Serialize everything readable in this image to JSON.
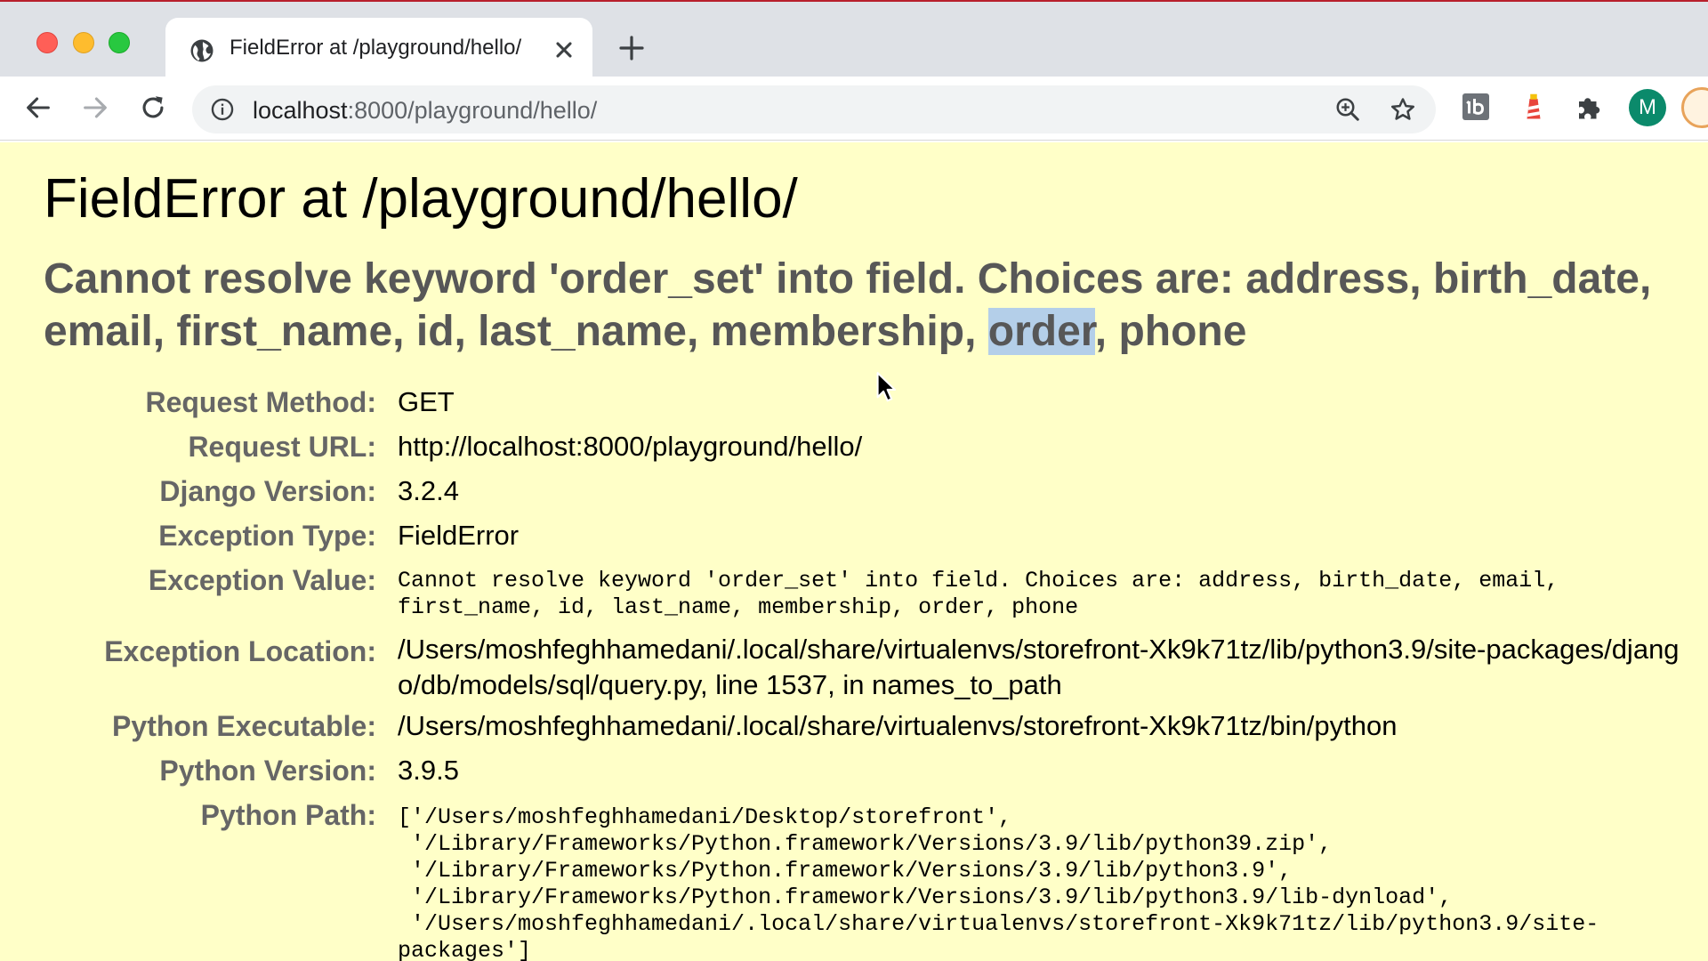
{
  "browser": {
    "tab_title": "FieldError at /playground/hello/",
    "url_host": "localhost",
    "url_rest": ":8000/playground/hello/",
    "profile_initial": "M",
    "accent": "#b8202c"
  },
  "page": {
    "title": "FieldError at /playground/hello/",
    "message_before": "Cannot resolve keyword 'order_set' into field. Choices are: address, birth_date, email, first_name, id, last_name, membership, ",
    "message_highlight": "order",
    "message_after": ", phone",
    "background": "#ffffc8",
    "meta": [
      {
        "label": "Request Method:",
        "value": "GET"
      },
      {
        "label": "Request URL:",
        "value": "http://localhost:8000/playground/hello/"
      },
      {
        "label": "Django Version:",
        "value": "3.2.4"
      },
      {
        "label": "Exception Type:",
        "value": "FieldError"
      },
      {
        "label": "Exception Value:",
        "value": "Cannot resolve keyword 'order_set' into field. Choices are: address, birth_date, email,\nfirst_name, id, last_name, membership, order, phone"
      },
      {
        "label": "Exception Location:",
        "value": "/Users/moshfeghhamedani/.local/share/virtualenvs/storefront-Xk9k71tz/lib/python3.9/site-packages/django/db/models/sql/query.py, line 1537, in names_to_path"
      },
      {
        "label": "Python Executable:",
        "value": "/Users/moshfeghhamedani/.local/share/virtualenvs/storefront-Xk9k71tz/bin/python"
      },
      {
        "label": "Python Version:",
        "value": "3.9.5"
      },
      {
        "label": "Python Path:",
        "value": "['/Users/moshfeghhamedani/Desktop/storefront',\n '/Library/Frameworks/Python.framework/Versions/3.9/lib/python39.zip',\n '/Library/Frameworks/Python.framework/Versions/3.9/lib/python3.9',\n '/Library/Frameworks/Python.framework/Versions/3.9/lib/python3.9/lib-dynload',\n '/Users/moshfeghhamedani/.local/share/virtualenvs/storefront-Xk9k71tz/lib/python3.9/site-\npackages']"
      }
    ]
  }
}
